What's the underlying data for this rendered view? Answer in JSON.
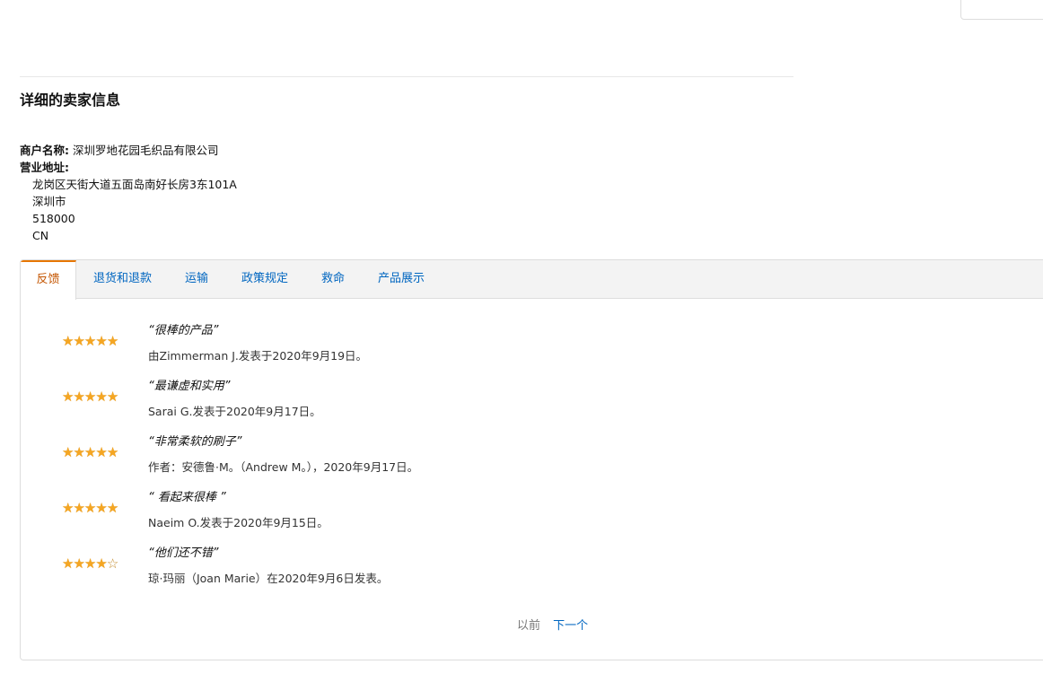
{
  "section": {
    "title": "详细的卖家信息"
  },
  "seller": {
    "name_label": "商户名称:",
    "name_value": "深圳罗地花园毛织品有限公司",
    "address_label": "营业地址:",
    "address_lines": [
      "龙岗区天街大道五面岛南好长房3东101A",
      "深圳市",
      "518000",
      "CN"
    ]
  },
  "tabs": [
    {
      "label": "反馈",
      "active": true
    },
    {
      "label": "退货和退款",
      "active": false
    },
    {
      "label": "运输",
      "active": false
    },
    {
      "label": "政策规定",
      "active": false
    },
    {
      "label": "救命",
      "active": false
    },
    {
      "label": "产品展示",
      "active": false
    }
  ],
  "reviews": [
    {
      "rating": 5,
      "max_rating": 5,
      "quote": "“很棒的产品”",
      "meta": "由Zimmerman J.发表于2020年9月19日。"
    },
    {
      "rating": 5,
      "max_rating": 5,
      "quote": "“最谦虚和实用”",
      "meta": "Sarai G.发表于2020年9月17日。"
    },
    {
      "rating": 5,
      "max_rating": 5,
      "quote": "“非常柔软的刷子”",
      "meta": "作者：安德鲁·M。（Andrew M。），2020年9月17日。"
    },
    {
      "rating": 5,
      "max_rating": 5,
      "quote": "“ 看起来很棒 ”",
      "meta": "Naeim O.发表于2020年9月15日。"
    },
    {
      "rating": 4,
      "max_rating": 5,
      "quote": "“他们还不错”",
      "meta": "琼·玛丽（Joan Marie）在2020年9月6日发表。"
    }
  ],
  "pagination": {
    "prev_label": "以前",
    "next_label": "下一个"
  },
  "colors": {
    "link": "#0066c0",
    "active_tab": "#c45500",
    "active_tab_border": "#e77600",
    "star": "#f5a623"
  },
  "icons": {
    "star_full": "star-icon",
    "star_empty": "star-outline-icon"
  }
}
